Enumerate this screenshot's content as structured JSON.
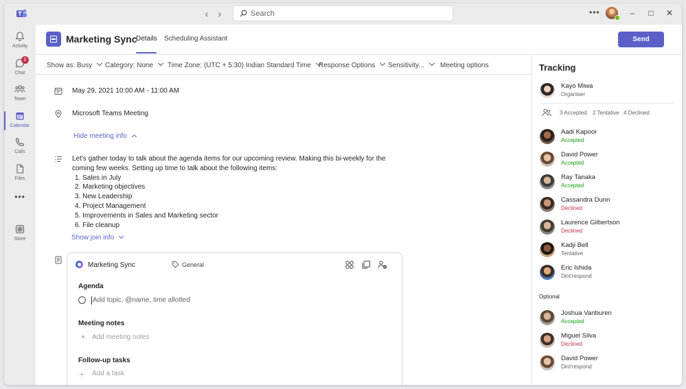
{
  "app": {
    "search_placeholder": "Search",
    "accent": "#5b5fc7"
  },
  "rail": {
    "items": [
      {
        "label": "Activity"
      },
      {
        "label": "Chat",
        "badge": "2"
      },
      {
        "label": "Team"
      },
      {
        "label": "Calendar"
      },
      {
        "label": "Calls"
      },
      {
        "label": "Files"
      },
      {
        "label": "Store"
      }
    ]
  },
  "meeting": {
    "title": "Marketing Sync",
    "tabs": [
      "Details",
      "Scheduling Assistant"
    ],
    "send_label": "Send",
    "options": [
      "Show as: Busy",
      "Category: None",
      "Time Zone: (UTC + 5:30) Indian Standard Time",
      "Response Options",
      "Sensitivity...",
      "Meeting options"
    ],
    "datetime": "May 29, 2021 10:00 AM - 11:00 AM",
    "location": "Microsoft Teams Meeting",
    "hide_info_label": "Hide meeting info",
    "description_intro": "Let's gather today to talk about the agenda items for our upcoming review. Making this bi-weekly for the coming few weeks. Setting up time to talk about the following items:",
    "description_items": [
      "1. Sales in July",
      "2. Marketing objectives",
      "3. New Leadership",
      "4. Project Management",
      "5. Improvements in Sales and Marketing sector",
      "6. File cleanup"
    ],
    "show_join_label": "Show join info"
  },
  "loop_card": {
    "title": "Marketing Sync",
    "tag": "General",
    "agenda_title": "Agenda",
    "agenda_placeholder": "Add topic, @name, time allotted",
    "notes_title": "Meeting notes",
    "notes_placeholder": "Add meeting notes",
    "tasks_title": "Follow-up tasks",
    "tasks_placeholder": "Add a task"
  },
  "tracking": {
    "title": "Tracking",
    "organiser": {
      "name": "Kayo Miwa",
      "role": "Organiser"
    },
    "counts": {
      "accepted": "3 Accepted",
      "tentative": "2 Tentative",
      "declined": "4 Declined"
    },
    "required": [
      {
        "name": "Aadi Kapoor",
        "status": "Accepted"
      },
      {
        "name": "David Power",
        "status": "Accepted"
      },
      {
        "name": "Ray Tanaka",
        "status": "Accepted"
      },
      {
        "name": "Cassandra Dunn",
        "status": "Declined"
      },
      {
        "name": "Laurence Gilbertson",
        "status": "Declined"
      },
      {
        "name": "Kadji Bell",
        "status": "Tentative"
      },
      {
        "name": "Eric Ishida",
        "status": "Dint'respond"
      }
    ],
    "optional_label": "Optional",
    "optional": [
      {
        "name": "Joshua Vanburen",
        "status": "Accepted"
      },
      {
        "name": "Miguel Silva",
        "status": "Declined"
      },
      {
        "name": "David Power",
        "status": "Dint'respond"
      }
    ]
  }
}
